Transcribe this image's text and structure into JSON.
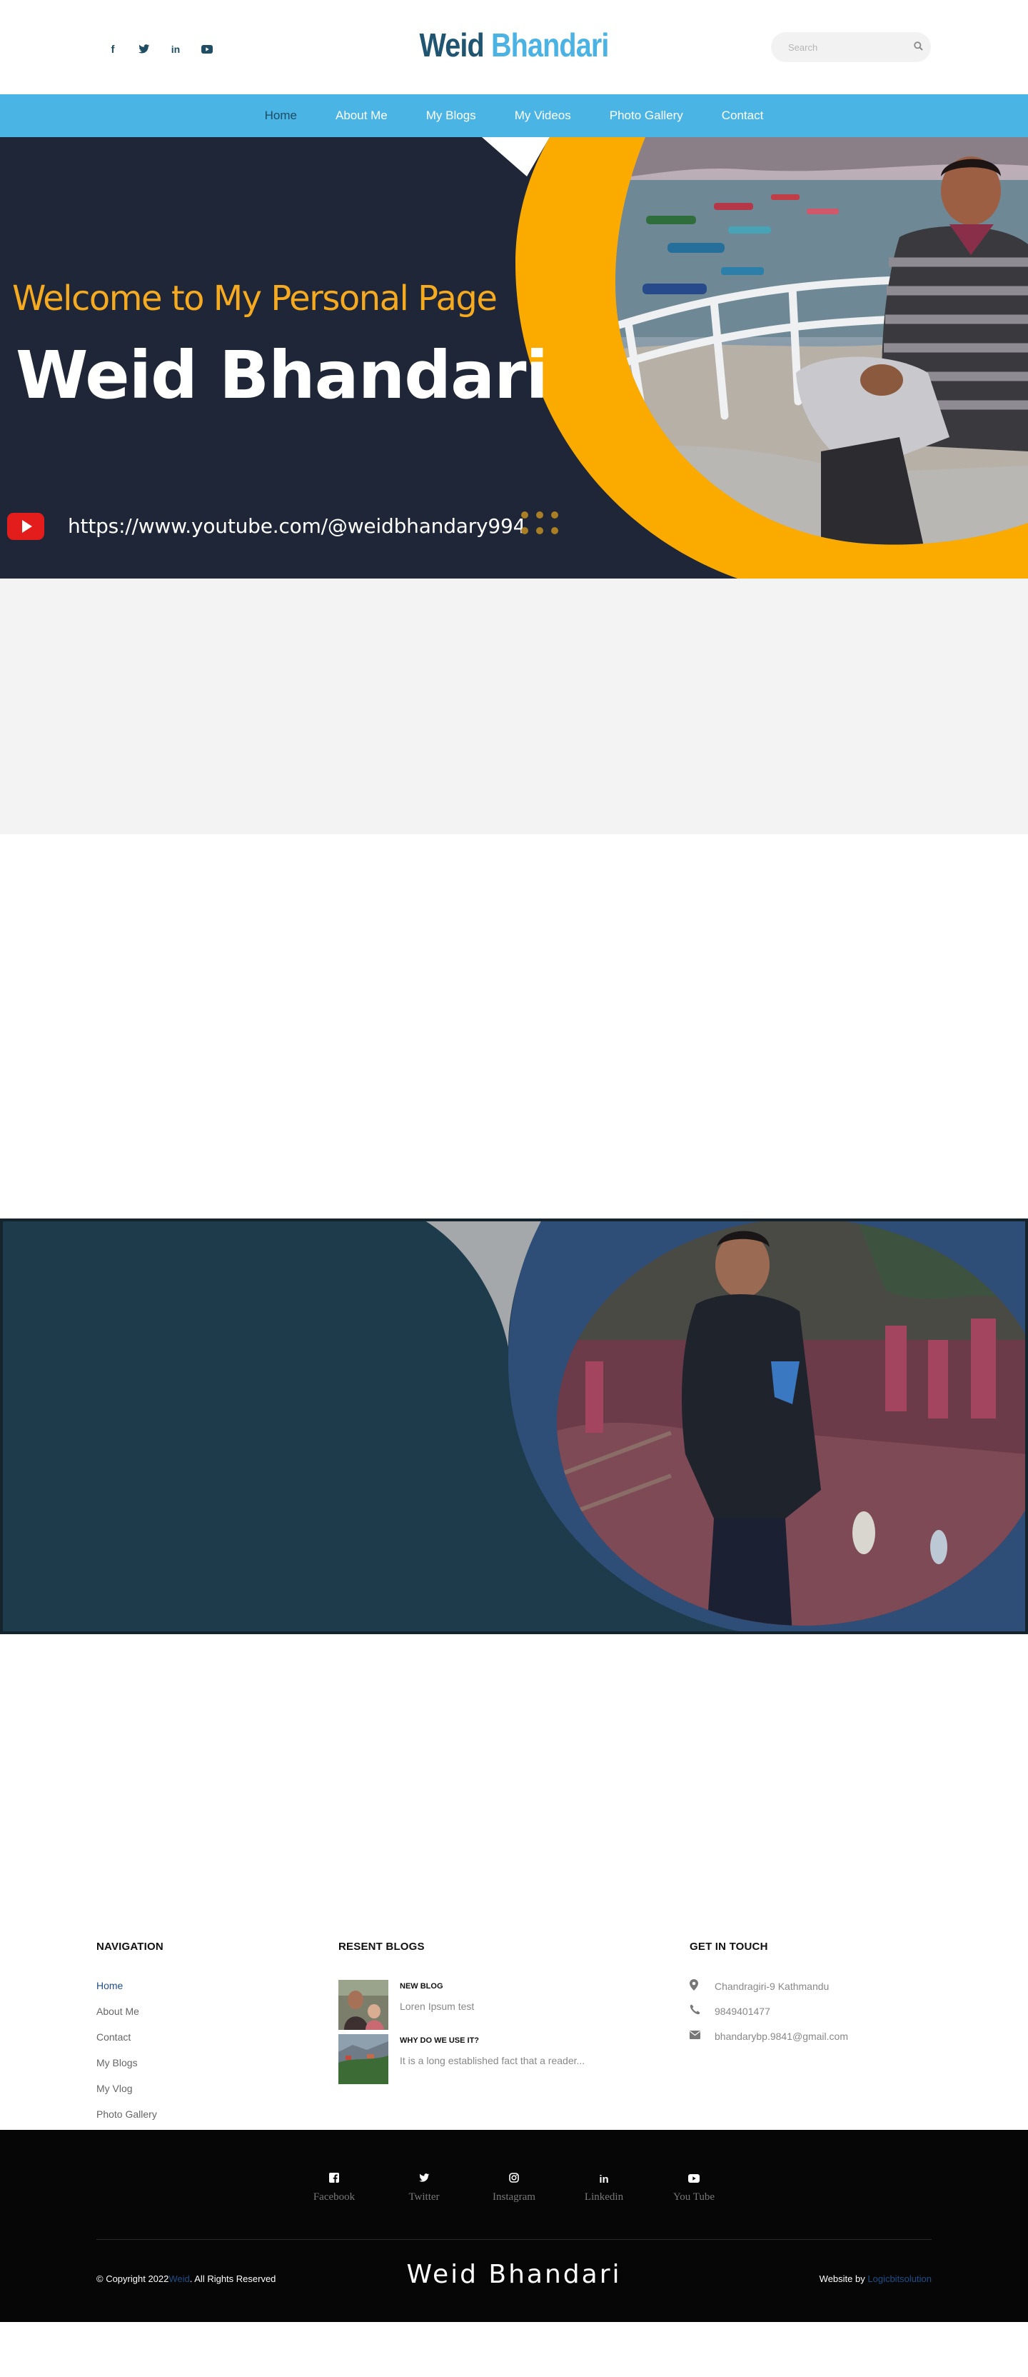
{
  "header": {
    "logo_first": "Weid",
    "logo_second": "Bhandari",
    "search_placeholder": "Search",
    "social_icons": [
      {
        "name": "facebook-icon",
        "glyph": "f"
      },
      {
        "name": "twitter-icon",
        "glyph": "🐦"
      },
      {
        "name": "linkedin-icon",
        "glyph": "in"
      },
      {
        "name": "youtube-icon",
        "glyph": "▶"
      }
    ]
  },
  "nav": {
    "items": [
      "Home",
      "About Me",
      "My Blogs",
      "My Videos",
      "Photo Gallery",
      "Contact"
    ],
    "active": "Home"
  },
  "hero": {
    "welcome": "Welcome to My Personal Page",
    "name": "Weid Bhandari",
    "url": "https://www.youtube.com/@weidbhandary994"
  },
  "footer": {
    "navigation_title": "NAVIGATION",
    "navigation_items": [
      "Home",
      "About Me",
      "Contact",
      "My Blogs",
      "My Vlog",
      "Photo Gallery"
    ],
    "blogs_title": "RESENT BLOGS",
    "blogs": [
      {
        "title": "NEW BLOG",
        "excerpt": "Loren Ipsum test"
      },
      {
        "title": "WHY DO WE USE IT?",
        "excerpt": "It is a long established fact that a reader..."
      }
    ],
    "contact_title": "GET IN TOUCH",
    "contact": [
      {
        "icon": "map-marker-icon",
        "glyph": "⬤",
        "text": "Chandragiri-9 Kathmandu"
      },
      {
        "icon": "phone-icon",
        "glyph": "✆",
        "text": "9849401477"
      },
      {
        "icon": "envelope-icon",
        "glyph": "✉",
        "text": "bhandarybp.9841@gmail.com"
      }
    ],
    "social": [
      {
        "icon": "facebook-icon",
        "glyph": "f",
        "label": "Facebook"
      },
      {
        "icon": "twitter-icon",
        "glyph": "🐦",
        "label": "Twitter"
      },
      {
        "icon": "instagram-icon",
        "glyph": "◎",
        "label": "Instagram"
      },
      {
        "icon": "linkedin-icon",
        "glyph": "in",
        "label": "Linkedin"
      },
      {
        "icon": "youtube-icon",
        "glyph": "▶",
        "label": "You Tube"
      }
    ],
    "copyright_prefix": "© Copyright 2022",
    "copyright_name": "Weid",
    "copyright_suffix": ". All Rights Reserved",
    "brand": "Weid Bhandari",
    "website_by_prefix": "Website by",
    "website_by_name": "Logicbitsolution"
  },
  "colors": {
    "nav_bg": "#4ab5e5",
    "hero_bg": "#1e2637",
    "accent_orange": "#f5aa1f",
    "banner2_bg": "#1e3b4c",
    "logo_dark": "#1f5570",
    "logo_light": "#4ab3e4"
  }
}
